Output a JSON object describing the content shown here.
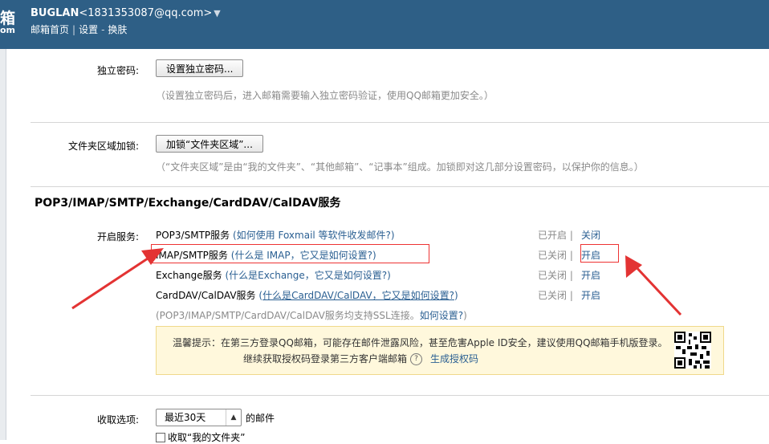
{
  "header": {
    "logo_char": "箱",
    "logo_sub": "om",
    "account_name": "BUGLAN",
    "account_email": "<1831353087@qq.com>",
    "nav": [
      "邮箱首页",
      "设置",
      "换肤"
    ]
  },
  "security": {
    "independent_pw_label": "独立密码:",
    "independent_pw_button": "设置独立密码...",
    "independent_pw_note": "（设置独立密码后，进入邮箱需要输入独立密码验证，使用QQ邮箱更加安全。）",
    "folder_lock_label": "文件夹区域加锁:",
    "folder_lock_button": "加锁“文件夹区域”...",
    "folder_lock_note": "（“文件夹区域”是由“我的文件夹”、“其他邮箱”、“记事本”组成。加锁即对这几部分设置密码，以保护你的信息。）"
  },
  "protocols": {
    "section_title": "POP3/IMAP/SMTP/Exchange/CardDAV/CalDAV服务",
    "enable_label": "开启服务:",
    "services": [
      {
        "name": "POP3/SMTP服务",
        "help_prefix": "(",
        "help_link": "如何使用 Foxmail 等软件收发邮件?",
        "help_suffix": ")",
        "status": "已开启",
        "sep": "|",
        "action": "关闭"
      },
      {
        "name": "IMAP/SMTP服务",
        "help_prefix": "(",
        "help_link": "什么是 IMAP，它又是如何设置?",
        "help_suffix": ")",
        "status": "已关闭",
        "sep": "|",
        "action": "开启"
      },
      {
        "name": "Exchange服务",
        "help_prefix": "(",
        "help_link": "什么是Exchange，它又是如何设置?",
        "help_suffix": ")",
        "status": "已关闭",
        "sep": "|",
        "action": "开启"
      },
      {
        "name": "CardDAV/CalDAV服务",
        "help_prefix": "(",
        "help_link": "什么是CardDAV/CalDAV，它又是如何设置?",
        "help_suffix": ")",
        "status": "已关闭",
        "sep": "|",
        "action": "开启"
      }
    ],
    "ssl_note": "(POP3/IMAP/SMTP/CardDAV/CalDAV服务均支持SSL连接。",
    "ssl_link": "如何设置?",
    "ssl_suffix": ")",
    "warning_line1": "温馨提示：在第三方登录QQ邮箱，可能存在邮件泄露风险，甚至危害Apple ID安全，建议使用QQ邮箱手机版登录。",
    "warning_line2": "继续获取授权码登录第三方客户端邮箱",
    "warning_help": "?",
    "warning_link": "生成授权码"
  },
  "receive": {
    "label": "收取选项:",
    "selected": "最近30天",
    "suffix": "的邮件",
    "checkbox_label": "收取“我的文件夹”"
  },
  "colors": {
    "header": "#2e5f86",
    "link": "#2a5f92",
    "annotation": "#e33333"
  },
  "icons": [
    "dropdown-caret-icon",
    "help-circle-icon",
    "qr-code-icon",
    "checkbox-icon",
    "red-arrow-annotation"
  ]
}
